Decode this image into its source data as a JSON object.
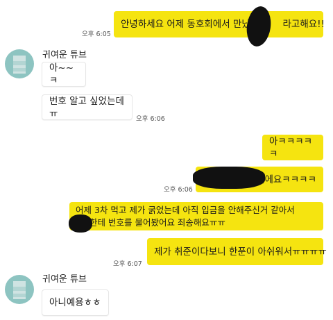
{
  "conversation": {
    "contact_name": "귀여운 튜브",
    "messages": [
      {
        "id": 1,
        "from": "me",
        "text": "안녕하세요 어제 동호회에서 만났던        라고해요!!",
        "time": "오후 6:05"
      },
      {
        "id": 2,
        "from": "them",
        "text": "아~~ㅋ"
      },
      {
        "id": 3,
        "from": "them",
        "text": "번호 알고 싶었는데ㅠ",
        "time": "오후 6:06"
      },
      {
        "id": 4,
        "from": "me",
        "text": "아ㅋㅋㅋㅋㅋ"
      },
      {
        "id": 5,
        "from": "me",
        "text": "이에요ㅋㅋㅋㅋ",
        "time": "오후 6:06"
      },
      {
        "id": 6,
        "from": "me",
        "line1": "어제 3차 먹고 제가 굵었는데 아직 입금을 안해주신거 같아서",
        "line2": "한테 번호를 물어봤어요 죄송해요ㅠㅠ"
      },
      {
        "id": 7,
        "from": "me",
        "text": "제가 취준이다보니 한푼이 아쉬워서ㅠㅠㅠㅠ",
        "time": "오후 6:07"
      },
      {
        "id": 8,
        "from": "them",
        "text": "아니예용ㅎㅎ"
      }
    ]
  },
  "colors": {
    "my_bubble": "#f5e410",
    "their_bubble": "#ffffff",
    "avatar": "#8dc4c1"
  },
  "icons": {
    "avatar": "avatar-icon"
  }
}
